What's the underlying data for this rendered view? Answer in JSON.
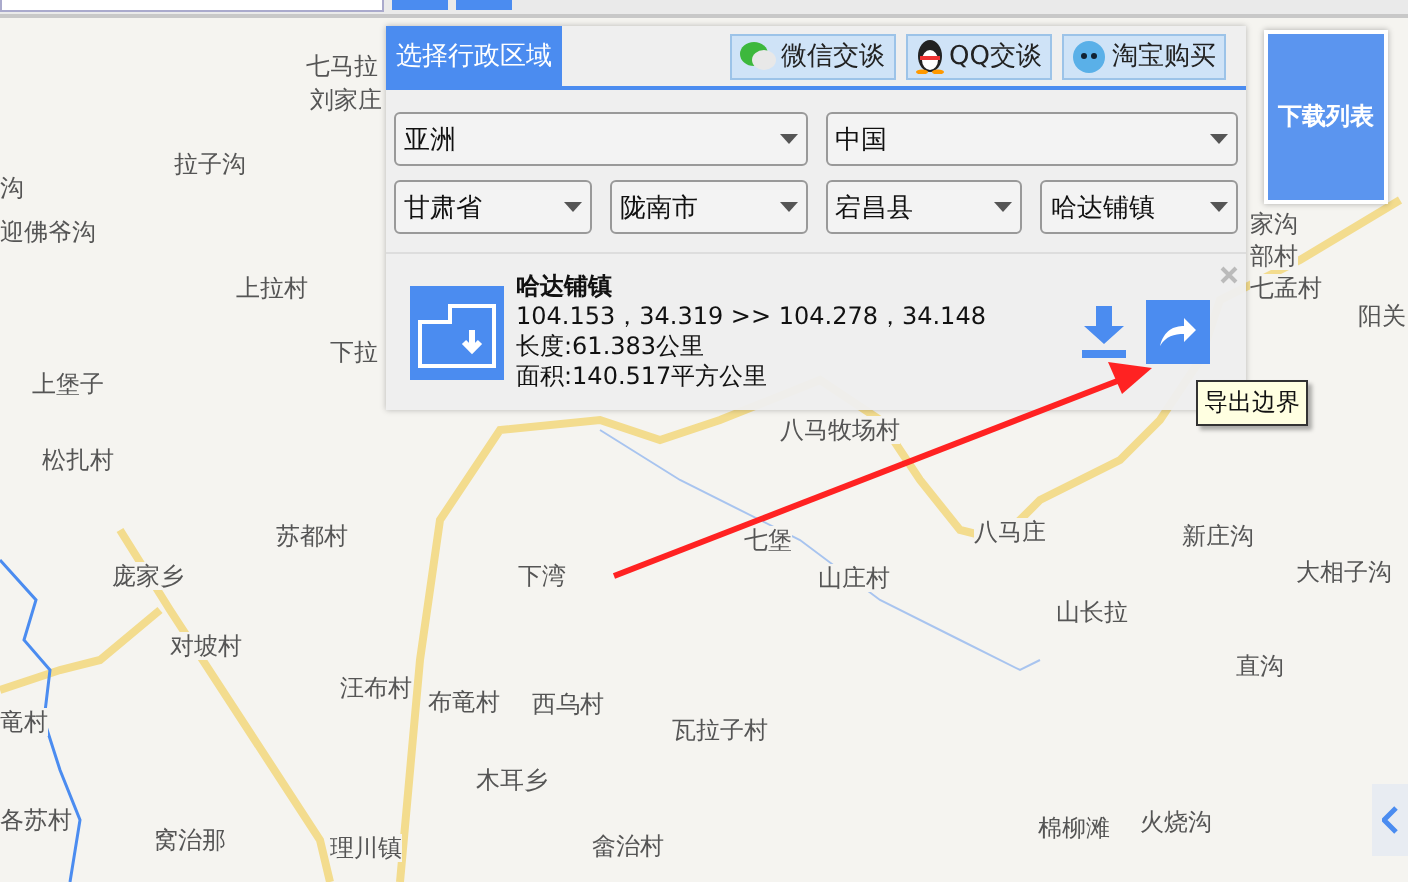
{
  "map_labels": [
    "七马拉",
    "刘家庄",
    "拉子沟",
    "沟",
    "迎佛爷沟",
    "上拉村",
    "下拉",
    "上堡子",
    "松扎村",
    "苏都村",
    "庞家乡",
    "对坡村",
    "汪布村",
    "竜村",
    "各苏村",
    "窝治那",
    "理川镇",
    "家沟",
    "部村",
    "七孟村",
    "阳关",
    "八马牧场村",
    "七堡",
    "下湾",
    "八马庄",
    "山庄村",
    "新庄沟",
    "大相子沟",
    "山长拉",
    "直沟",
    "布竜村",
    "西乌村",
    "瓦拉子村",
    "木耳乡",
    "畲治村",
    "棉柳滩",
    "火烧沟"
  ],
  "panel": {
    "tab": {
      "label": "选择行政区域",
      "selected": true
    },
    "buttons": [
      {
        "kind": "wechat",
        "label": "微信交谈"
      },
      {
        "kind": "qq",
        "label": "QQ交谈"
      },
      {
        "kind": "taobao",
        "label": "淘宝购买"
      }
    ],
    "region_row": [
      "亚洲",
      "中国"
    ],
    "detail_row": [
      "甘肃省",
      "陇南市",
      "宕昌县",
      "哈达铺镇"
    ],
    "result": {
      "name": "哈达铺镇",
      "coords": "104.153，34.319 >> 104.278，34.148",
      "length": "长度:61.383公里",
      "area": "面积:140.517平方公里"
    },
    "tooltip": "导出边界"
  },
  "download_list_button": "下载列表"
}
